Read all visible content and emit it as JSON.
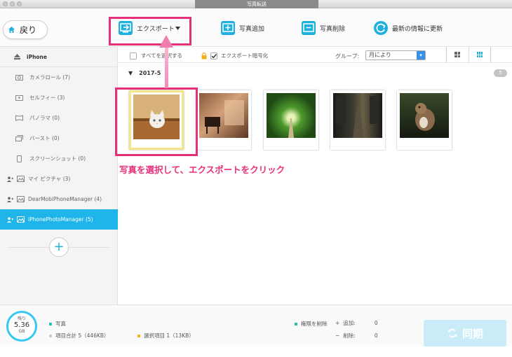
{
  "window": {
    "title": "写真転送"
  },
  "toolbar": {
    "back_label": "戻り",
    "export_label": "エクスポート",
    "add_photo_label": "写真追加",
    "delete_photo_label": "写真削除",
    "refresh_label": "最新の情報に更新"
  },
  "sidebar": {
    "device": "iPhone",
    "items": [
      {
        "label": "カメラロール (7)",
        "icon": "camera-icon"
      },
      {
        "label": "セルフィー (3)",
        "icon": "selfie-icon"
      },
      {
        "label": "パノラマ (0)",
        "icon": "panorama-icon"
      },
      {
        "label": "バースト (0)",
        "icon": "burst-icon"
      },
      {
        "label": "スクリーンショット (0)",
        "icon": "phone-icon"
      },
      {
        "label": "マイ ピクチャ (3)",
        "icon": "album-icon"
      },
      {
        "label": "DearMobiPhoneManager (4)",
        "icon": "album-icon"
      },
      {
        "label": "iPhonePhotoManager (5)",
        "icon": "album-icon",
        "selected": true
      }
    ],
    "add_album_label": "+"
  },
  "main": {
    "select_all_label": "すべてを選択する",
    "export_encrypt_label": "エクスポート暗号化",
    "group_label": "グループ:",
    "group_value": "月により",
    "date_group": "2017-5",
    "count": "5",
    "photos": [
      {
        "name": "kitten",
        "selected": true
      },
      {
        "name": "piano-room",
        "selected": false
      },
      {
        "name": "tree-road",
        "selected": false
      },
      {
        "name": "night-street",
        "selected": false
      },
      {
        "name": "squirrel",
        "selected": false
      }
    ]
  },
  "annotation": {
    "caption": "写真を選択して、エクスポートをクリック"
  },
  "bottom": {
    "storage_caption": "残り",
    "storage_value": "5.36",
    "storage_unit": "GB",
    "photos_label": "写真",
    "total_label": "項目合計 5（446KB）",
    "selected_label": "選択項目 1（13KB）",
    "permission_delete_label": "権限を削除",
    "add_label": "追加:",
    "add_count": "0",
    "delete_label": "削除:",
    "delete_count": "0",
    "sync_label": "同期"
  },
  "colors": {
    "accent": "#1fb5ea",
    "annotation": "#e8307a"
  }
}
